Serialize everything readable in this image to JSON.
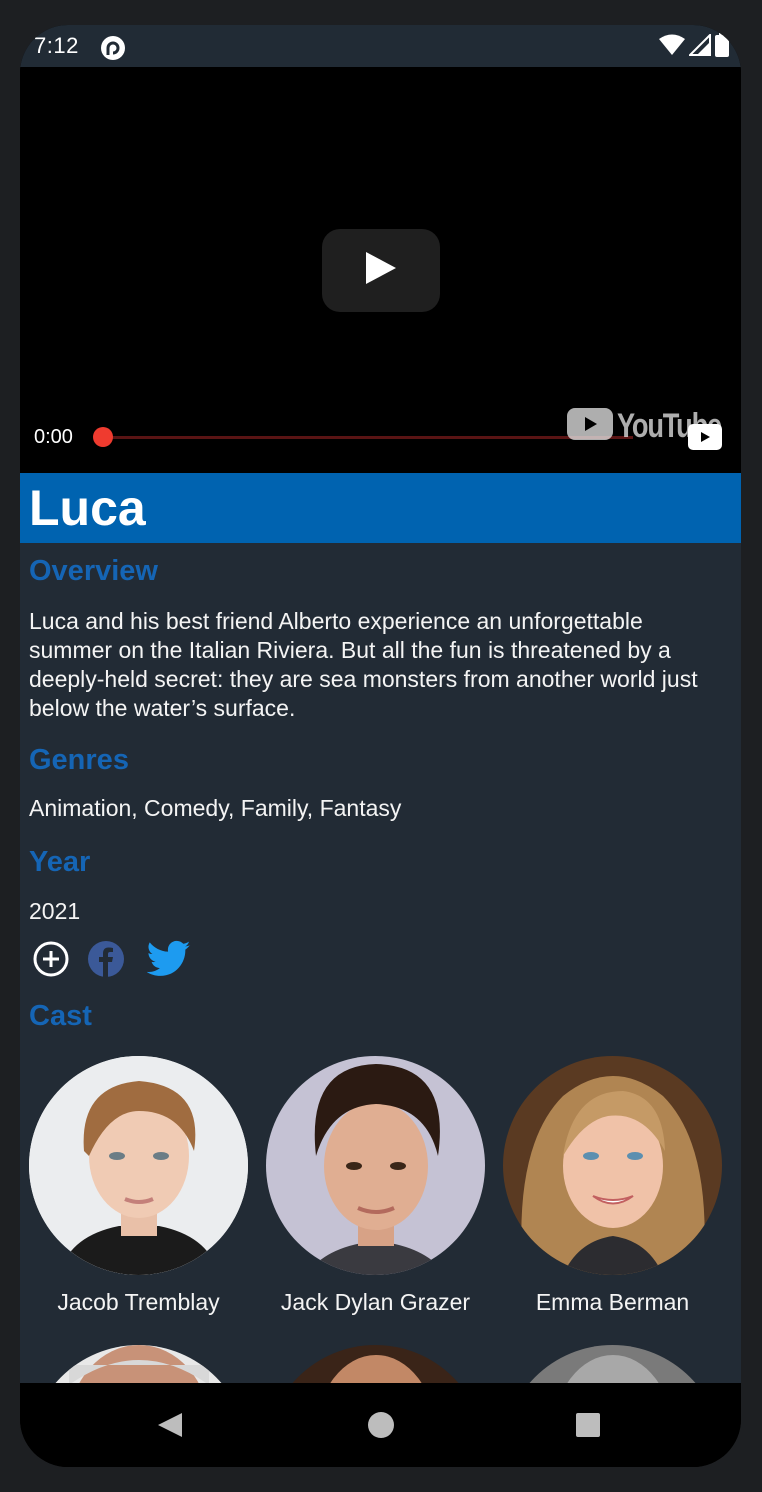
{
  "status_bar": {
    "time": "7:12",
    "app_icon": "pocket-casts-icon",
    "wifi_icon": "wifi-icon",
    "signal_icon": "cell-signal-icon",
    "battery_icon": "battery-icon"
  },
  "video": {
    "current_time": "0:00",
    "progress": 0,
    "logo_text": "YouTube",
    "play_icon": "play-icon"
  },
  "movie": {
    "title": "Luca"
  },
  "overview": {
    "heading": "Overview",
    "text": "Luca and his best friend Alberto experience an unforgettable summer on the Italian Riviera. But all the fun is threatened by a deeply-held secret: they are sea monsters from another world just below the water’s surface."
  },
  "genres": {
    "heading": "Genres",
    "text": "Animation, Comedy, Family, Fantasy"
  },
  "year": {
    "heading": "Year",
    "text": "2021"
  },
  "actions": {
    "add_icon": "add-circle-icon",
    "facebook_icon": "facebook-icon",
    "twitter_icon": "twitter-icon"
  },
  "cast": {
    "heading": "Cast",
    "members": [
      {
        "name": "Jacob Tremblay"
      },
      {
        "name": "Jack Dylan Grazer"
      },
      {
        "name": "Emma Berman"
      }
    ]
  },
  "nav_bar": {
    "back_icon": "back-triangle-icon",
    "home_icon": "home-circle-icon",
    "recents_icon": "recents-square-icon"
  },
  "colors": {
    "accent": "#0063b0",
    "heading": "#1565b5",
    "background": "#222b35",
    "facebook": "#3b5998",
    "twitter": "#1d9bf0",
    "progress": "#ef3b2f"
  }
}
